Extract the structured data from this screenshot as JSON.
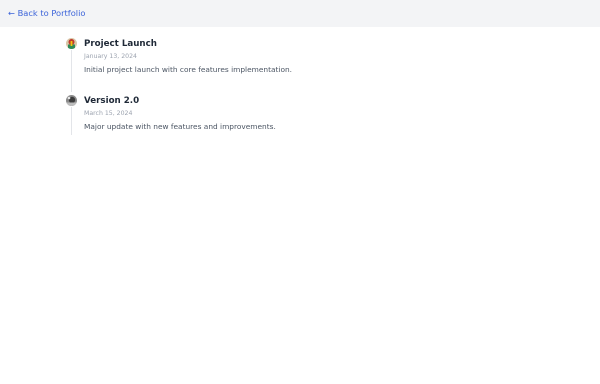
{
  "nav": {
    "back_label": "← Back to Portfolio"
  },
  "timeline": {
    "items": [
      {
        "title": "Project Launch",
        "date": "January 13, 2024",
        "description": "Initial project launch with core features implementation.",
        "icon": "project-launch-thumbnail"
      },
      {
        "title": "Version 2.0",
        "date": "March 15, 2024",
        "description": "Major update with new features and improvements.",
        "icon": "version-thumbnail"
      }
    ]
  },
  "colors": {
    "link": "#3b63d9",
    "topbar_bg": "#f3f4f6",
    "timeline_line": "#e3e5e9",
    "title": "#1f2937",
    "muted": "#9ca3af",
    "body_text": "#4b5563"
  }
}
